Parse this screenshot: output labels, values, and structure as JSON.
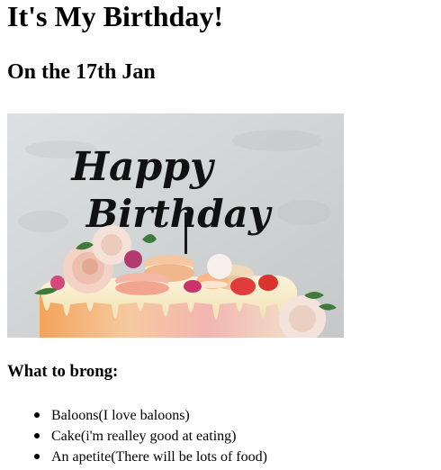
{
  "heading": "It's My Birthday!",
  "date": "On the 17th Jan",
  "image": {
    "topper_line1": "Happy",
    "topper_line2": "Birthday",
    "topper_color": "#111111"
  },
  "list_title": "What to brong:",
  "items": [
    "Baloons(I love baloons)",
    "Cake(i'm realley good at eating)",
    "An apetite(There will be lots of food)"
  ]
}
